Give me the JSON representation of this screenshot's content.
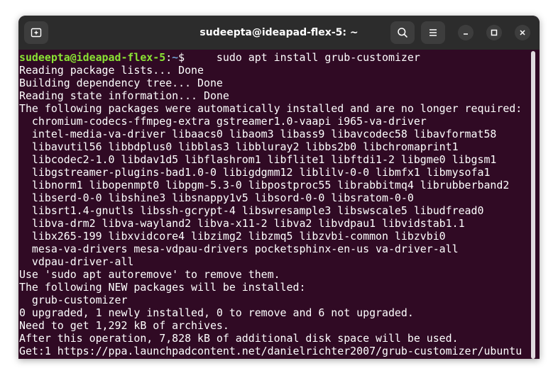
{
  "window": {
    "title": "sudeepta@ideapad-flex-5: ~"
  },
  "titlebar": {
    "new_tab_icon": "new-tab-icon",
    "search_icon": "search-icon",
    "menu_icon": "hamburger-menu-icon",
    "minimize_icon": "minimize-icon",
    "maximize_icon": "maximize-icon",
    "close_icon": "close-icon"
  },
  "prompt": {
    "user_host": "sudeepta@ideapad-flex-5",
    "colon": ":",
    "path": "~",
    "symbol": "$",
    "command": "     sudo apt install grub-customizer"
  },
  "output": [
    "Reading package lists... Done",
    "Building dependency tree... Done",
    "Reading state information... Done",
    "The following packages were automatically installed and are no longer required:",
    "  chromium-codecs-ffmpeg-extra gstreamer1.0-vaapi i965-va-driver",
    "  intel-media-va-driver libaacs0 libaom3 libass9 libavcodec58 libavformat58",
    "  libavutil56 libbdplus0 libblas3 libbluray2 libbs2b0 libchromaprint1",
    "  libcodec2-1.0 libdav1d5 libflashrom1 libflite1 libftdi1-2 libgme0 libgsm1",
    "  libgstreamer-plugins-bad1.0-0 libigdgmm12 liblilv-0-0 libmfx1 libmysofa1",
    "  libnorm1 libopenmpt0 libpgm-5.3-0 libpostproc55 librabbitmq4 librubberband2",
    "  libserd-0-0 libshine3 libsnappy1v5 libsord-0-0 libsratom-0-0",
    "  libsrt1.4-gnutls libssh-gcrypt-4 libswresample3 libswscale5 libudfread0",
    "  libva-drm2 libva-wayland2 libva-x11-2 libva2 libvdpau1 libvidstab1.1",
    "  libx265-199 libxvidcore4 libzimg2 libzmq5 libzvbi-common libzvbi0",
    "  mesa-va-drivers mesa-vdpau-drivers pocketsphinx-en-us va-driver-all",
    "  vdpau-driver-all",
    "Use 'sudo apt autoremove' to remove them.",
    "The following NEW packages will be installed:",
    "  grub-customizer",
    "0 upgraded, 1 newly installed, 0 to remove and 6 not upgraded.",
    "Need to get 1,292 kB of archives.",
    "After this operation, 7,828 kB of additional disk space will be used.",
    "Get:1 https://ppa.launchpadcontent.net/danielrichter2007/grub-customizer/ubuntu"
  ]
}
